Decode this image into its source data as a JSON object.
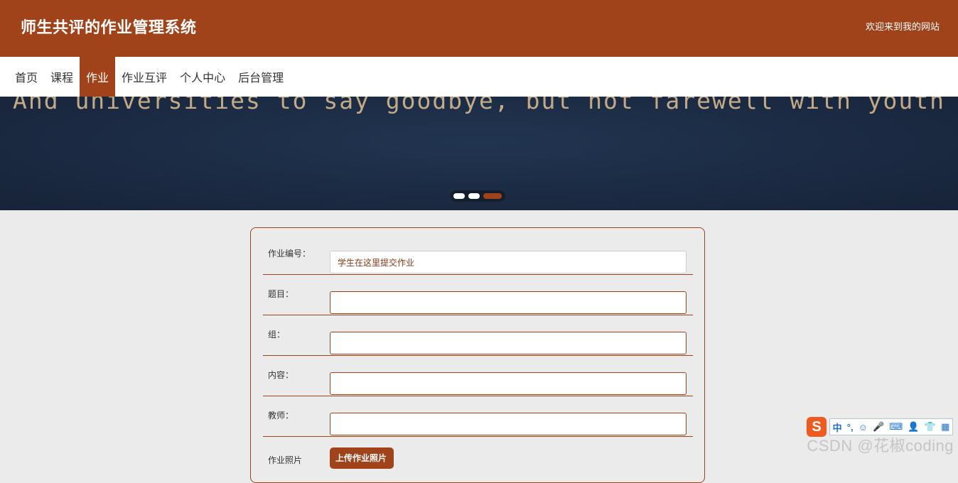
{
  "header": {
    "title": "师生共评的作业管理系统",
    "welcome": "欢迎来到我的网站"
  },
  "nav": {
    "items": [
      {
        "label": "首页",
        "active": false
      },
      {
        "label": "课程",
        "active": false
      },
      {
        "label": "作业",
        "active": true
      },
      {
        "label": "作业互评",
        "active": false
      },
      {
        "label": "个人中心",
        "active": false
      },
      {
        "label": "后台管理",
        "active": false
      }
    ]
  },
  "banner": {
    "text": "And universities to say goodbye, but not farewell with youth",
    "slide_count": 3,
    "active_slide": 2
  },
  "form": {
    "fields": [
      {
        "label": "作业编号：",
        "value": "学生在这里提交作业",
        "placeholder": ""
      },
      {
        "label": "题目：",
        "value": "",
        "placeholder": ""
      },
      {
        "label": "组：",
        "value": "",
        "placeholder": ""
      },
      {
        "label": "内容：",
        "value": "",
        "placeholder": ""
      },
      {
        "label": "教师：",
        "value": "",
        "placeholder": ""
      }
    ],
    "upload_label": "作业照片",
    "upload_button": "上传作业照片"
  },
  "ime": {
    "logo": "S",
    "items": [
      "中",
      "°,",
      "☺",
      "🎤",
      "⌨",
      "👤",
      "👕",
      "▦"
    ]
  },
  "watermark": "CSDN @花椒coding",
  "colors": {
    "brand": "#a0431a",
    "banner_bg": "#1b2a42",
    "page_bg": "#ebebeb"
  }
}
